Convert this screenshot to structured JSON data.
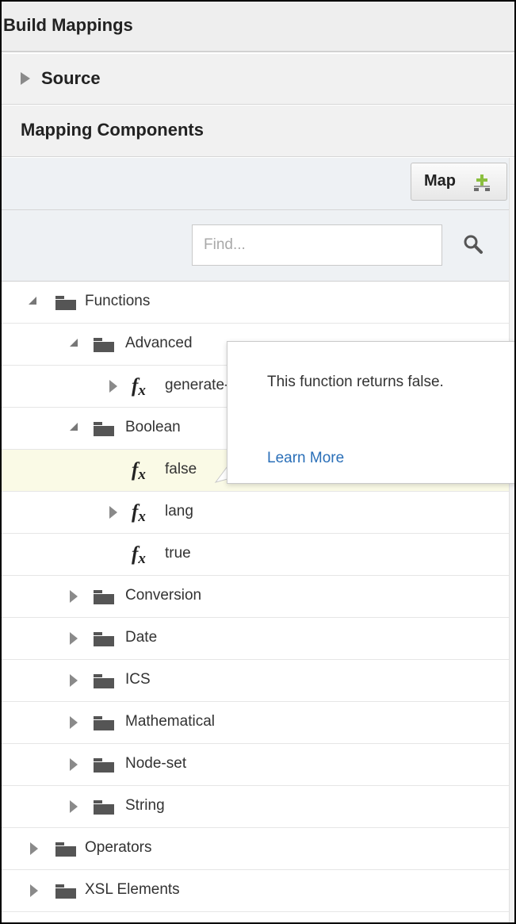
{
  "panel": {
    "title": "Build Mappings",
    "source_label": "Source",
    "mapping_components_label": "Mapping Components"
  },
  "toolbar": {
    "map_label": "Map",
    "map_icon": "add-map-icon"
  },
  "search": {
    "placeholder": "Find...",
    "value": "",
    "icon": "search-icon"
  },
  "tree": {
    "functions": "Functions",
    "advanced": "Advanced",
    "advanced_item": "generate-guid",
    "boolean": "Boolean",
    "false_fn": "false",
    "lang_fn": "lang",
    "true_fn": "true",
    "conversion": "Conversion",
    "date": "Date",
    "ics": "ICS",
    "mathematical": "Mathematical",
    "node_set": "Node-set",
    "string": "String",
    "operators": "Operators",
    "xsl_elements": "XSL Elements"
  },
  "tooltip": {
    "text": "This function returns false.",
    "link": "Learn More"
  },
  "colors": {
    "selected_row": "#fafae6",
    "link": "#2a6fb8",
    "header_bg": "#f1f1f1",
    "toolbar_bg": "#eef1f4"
  }
}
